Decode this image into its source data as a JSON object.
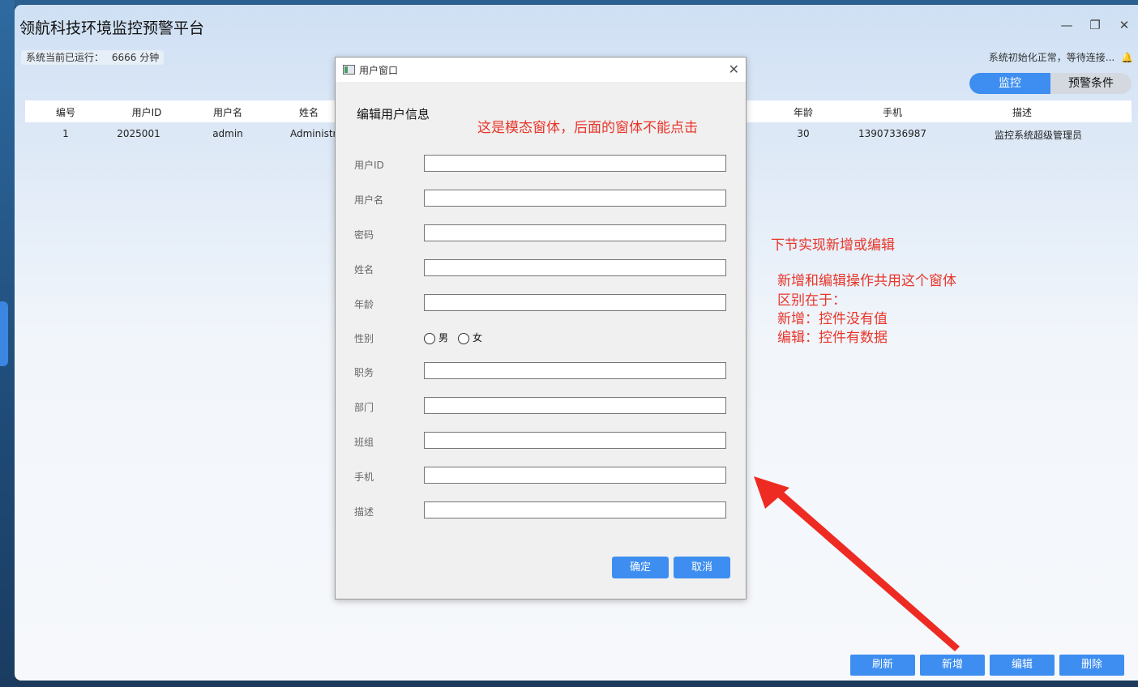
{
  "app": {
    "title": "领航科技环境监控预警平台",
    "runtime_label": "系统当前已运行：",
    "runtime_value": "6666 分钟",
    "status_right": "系统初始化正常，等待连接...",
    "window_controls": {
      "minimize": "—",
      "restore": "❐",
      "close": "✕"
    }
  },
  "tabs": [
    {
      "label": "监控",
      "active": true
    },
    {
      "label": "预警条件",
      "active": false
    }
  ],
  "table": {
    "columns": [
      "编号",
      "用户ID",
      "用户名",
      "姓名",
      "年龄",
      "手机",
      "描述"
    ],
    "rows": [
      {
        "id": "1",
        "user_id": "2025001",
        "username": "admin",
        "name": "Administrato",
        "age": "30",
        "phone": "13907336987",
        "desc": "监控系统超级管理员"
      }
    ]
  },
  "actions": [
    "刷新",
    "新增",
    "编辑",
    "删除"
  ],
  "modal": {
    "title": "用户窗口",
    "close": "✕",
    "heading": "编辑用户信息",
    "fields": [
      "用户ID",
      "用户名",
      "密码",
      "姓名",
      "年龄",
      "性别",
      "职务",
      "部门",
      "班组",
      "手机",
      "描述"
    ],
    "gender_options": [
      "男",
      "女"
    ],
    "ok": "确定",
    "cancel": "取消"
  },
  "annotations": {
    "modal_note": "这是模态窗体，后面的窗体不能点击",
    "next_title": "下节实现新增或编辑",
    "lines": [
      "新增和编辑操作共用这个窗体",
      "区别在于：",
      "新增：控件没有值",
      "编辑：控件有数据"
    ]
  },
  "colors": {
    "accent": "#3d8ef0",
    "annotation": "#e8352a"
  }
}
